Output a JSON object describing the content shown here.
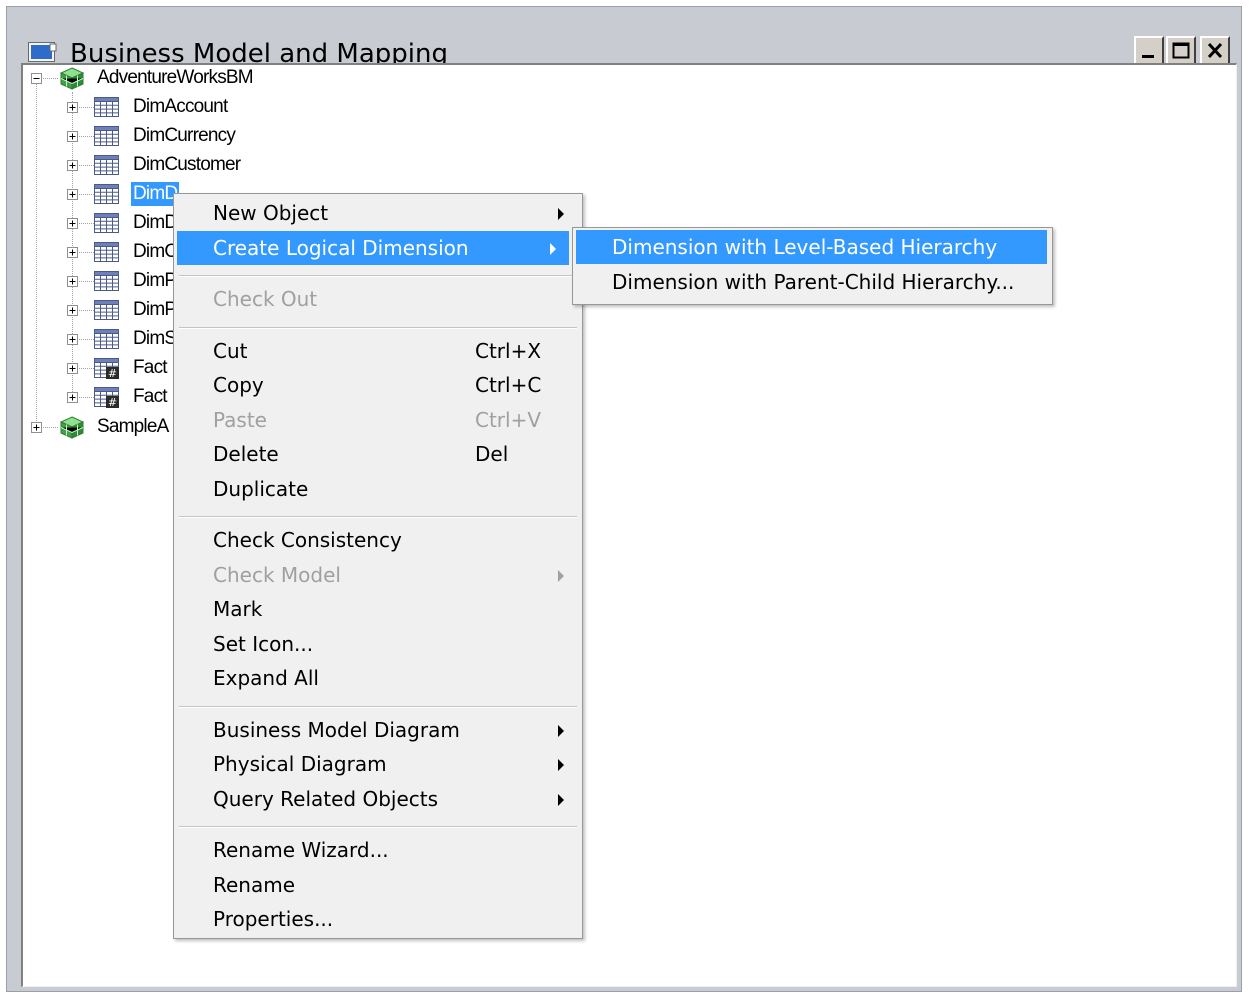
{
  "window": {
    "title": "Business Model and Mapping",
    "buttons": {
      "minimize": "minimize",
      "maximize": "maximize",
      "close": "close"
    }
  },
  "tree": {
    "root": {
      "label": "AdventureWorksBM",
      "icon": "business-model-cube-icon",
      "expanded": true
    },
    "children": [
      {
        "label": "DimAccount",
        "icon": "table-icon"
      },
      {
        "label": "DimCurrency",
        "icon": "table-icon"
      },
      {
        "label": "DimCustomer",
        "icon": "table-icon"
      },
      {
        "label": "DimD",
        "icon": "table-icon",
        "selected": true
      },
      {
        "label": "DimD",
        "icon": "table-icon"
      },
      {
        "label": "DimO",
        "icon": "table-icon"
      },
      {
        "label": "DimP",
        "icon": "table-icon"
      },
      {
        "label": "DimP",
        "icon": "table-icon"
      },
      {
        "label": "DimS",
        "icon": "table-icon"
      },
      {
        "label": "Fact",
        "icon": "fact-table-icon"
      },
      {
        "label": "Fact",
        "icon": "fact-table-icon"
      }
    ],
    "second_root": {
      "label": "SampleA",
      "icon": "business-model-cube-icon",
      "expanded": false
    }
  },
  "context_menu": {
    "items": [
      {
        "label": "New Object",
        "submenu": true
      },
      {
        "label": "Create Logical Dimension",
        "submenu": true,
        "highlighted": true
      },
      {
        "separator": true
      },
      {
        "label": "Check Out",
        "disabled": true
      },
      {
        "separator": true
      },
      {
        "label": "Cut",
        "shortcut": "Ctrl+X"
      },
      {
        "label": "Copy",
        "shortcut": "Ctrl+C"
      },
      {
        "label": "Paste",
        "shortcut": "Ctrl+V",
        "disabled": true
      },
      {
        "label": "Delete",
        "shortcut": "Del"
      },
      {
        "label": "Duplicate"
      },
      {
        "separator": true
      },
      {
        "label": "Check Consistency"
      },
      {
        "label": "Check Model",
        "submenu": true,
        "disabled": true
      },
      {
        "label": "Mark"
      },
      {
        "label": "Set Icon..."
      },
      {
        "label": "Expand All"
      },
      {
        "separator": true
      },
      {
        "label": "Business Model Diagram",
        "submenu": true
      },
      {
        "label": "Physical Diagram",
        "submenu": true
      },
      {
        "label": "Query Related Objects",
        "submenu": true
      },
      {
        "separator": true
      },
      {
        "label": "Rename Wizard..."
      },
      {
        "label": "Rename"
      },
      {
        "label": "Properties..."
      }
    ]
  },
  "submenu": {
    "items": [
      {
        "label": "Dimension with Level-Based Hierarchy",
        "highlighted": true
      },
      {
        "label": "Dimension with Parent-Child Hierarchy..."
      }
    ]
  },
  "colors": {
    "highlight": "#3399ff",
    "menu_bg": "#f0f0f0",
    "disabled_text": "#a0a0a0",
    "frame": "#c8ccd2"
  }
}
